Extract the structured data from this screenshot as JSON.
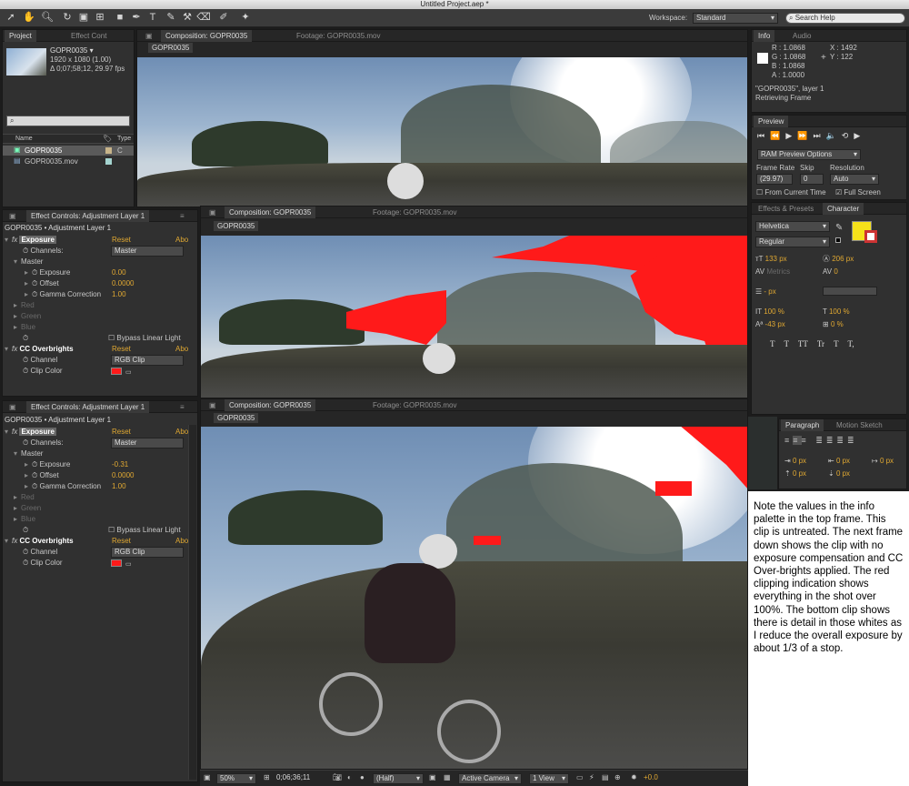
{
  "app": {
    "title": "Untitled Project.aep *"
  },
  "toolbar": {
    "workspace_label": "Workspace:",
    "workspace_value": "Standard",
    "search_placeholder": "Search Help"
  },
  "project": {
    "tabs": [
      "Project",
      "Effect Cont"
    ],
    "item_name": "GOPR0035 ▾",
    "item_dims": "1920 x 1080 (1.00)",
    "item_info": "Δ 0;07;58;12, 29.97 fps",
    "col_name": "Name",
    "col_type": "Type",
    "items": [
      {
        "name": "GOPR0035",
        "type": "C"
      },
      {
        "name": "GOPR0035.mov",
        "type": ""
      }
    ]
  },
  "viewer_top": {
    "tab_comp": "Composition: GOPR0035",
    "tab_footage": "Footage: GOPR0035.mov",
    "comp_label": "GOPR0035"
  },
  "viewer_mid": {
    "tab_comp": "Composition: GOPR0035",
    "tab_footage": "Footage: GOPR0035.mov",
    "comp_label": "GOPR0035"
  },
  "viewer_bot": {
    "tab_comp": "Composition: GOPR0035",
    "tab_footage": "Footage: GOPR0035.mov",
    "comp_label": "GOPR0035"
  },
  "effects_mid": {
    "tab": "Effect Controls: Adjustment Layer 1",
    "breadcrumb": "GOPR0035 • Adjustment Layer 1",
    "exposure": "Exposure",
    "reset": "Reset",
    "abo": "Abo",
    "channels_label": "Channels:",
    "channels_value": "Master",
    "master": "Master",
    "exposure_label": "Exposure",
    "exposure_value": "0.00",
    "offset_label": "Offset",
    "offset_value": "0.0000",
    "gamma_label": "Gamma Correction",
    "gamma_value": "1.00",
    "red": "Red",
    "green": "Green",
    "blue": "Blue",
    "bypass": "Bypass Linear Light",
    "cc": "CC Overbrights",
    "channel_label": "Channel",
    "channel_value": "RGB Clip",
    "clipcolor_label": "Clip Color"
  },
  "effects_bot": {
    "tab": "Effect Controls: Adjustment Layer 1",
    "breadcrumb": "GOPR0035 • Adjustment Layer 1",
    "exposure": "Exposure",
    "reset": "Reset",
    "abo": "Abo",
    "channels_label": "Channels:",
    "channels_value": "Master",
    "master": "Master",
    "exposure_label": "Exposure",
    "exposure_value": "-0.31",
    "offset_label": "Offset",
    "offset_value": "0.0000",
    "gamma_label": "Gamma Correction",
    "gamma_value": "1.00",
    "red": "Red",
    "green": "Green",
    "blue": "Blue",
    "bypass": "Bypass Linear Light",
    "cc": "CC Overbrights",
    "channel_label": "Channel",
    "channel_value": "RGB Clip",
    "clipcolor_label": "Clip Color"
  },
  "info": {
    "tabs": [
      "Info",
      "Audio"
    ],
    "r": "R : 1.0868",
    "g": "G : 1.0868",
    "b": "B : 1.0868",
    "a": "A : 1.0000",
    "x": "X : 1492",
    "y": "Y : 122",
    "layer": "\"GOPR0035\", layer 1",
    "status": "Retrieving Frame"
  },
  "preview": {
    "tab": "Preview",
    "ram": "RAM Preview Options",
    "fr_label": "Frame Rate",
    "skip_label": "Skip",
    "res_label": "Resolution",
    "fr_value": "(29.97)",
    "skip_value": "0",
    "res_value": "Auto",
    "from_current": "From Current Time",
    "full_screen": "Full Screen"
  },
  "character": {
    "tabs": [
      "Effects & Presets",
      "Character"
    ],
    "font": "Helvetica",
    "style": "Regular",
    "size": "133 px",
    "leading": "206 px",
    "kerning": "Metrics",
    "tracking": "0",
    "stroke": "- px",
    "vscale": "100 %",
    "hscale": "100 %",
    "baseline": "-43 px",
    "tsume": "0 %",
    "fmt_buttons": [
      "T",
      "T",
      "TT",
      "Tr",
      "T",
      "T,"
    ],
    "fill_color": "#f5e11a"
  },
  "paragraph": {
    "tabs": [
      "Paragraph",
      "Motion Sketch"
    ],
    "indent_values": [
      "0 px",
      "0 px",
      "0 px",
      "0 px",
      "0 px"
    ]
  },
  "statusbar": {
    "zoom": "50%",
    "timecode": "0;06;36;11",
    "quality": "(Half)",
    "camera": "Active Camera",
    "views": "1 View",
    "offset": "+0.0"
  },
  "note": {
    "text": "Note the values in the info palette in the top frame. This clip is untreated. The next frame down shows the clip with no exposure compensation and CC Over-brights applied. The red clipping indication shows everything in the shot over 100%. The bottom clip shows there is detail in those whites as I reduce the overall exposure by about 1/3 of a stop."
  },
  "colors": {
    "clip_red": "#ff1a1a",
    "accent_orange": "#e0a832",
    "panel_bg": "#303030"
  }
}
